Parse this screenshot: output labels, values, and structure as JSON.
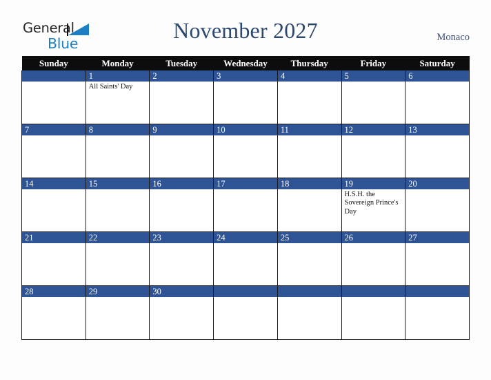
{
  "brand": {
    "word_one": "General",
    "word_two": "Blue",
    "accent_color": "#1c7fc4",
    "text_color": "#262626"
  },
  "header": {
    "title": "November 2027",
    "region": "Monaco",
    "title_color": "#2c4770"
  },
  "calendar": {
    "header_bg": "#0d0d0d",
    "daybar_bg": "#2f5495",
    "weekday_headers": [
      "Sunday",
      "Monday",
      "Tuesday",
      "Wednesday",
      "Thursday",
      "Friday",
      "Saturday"
    ],
    "weeks": [
      [
        {
          "day": "",
          "events": []
        },
        {
          "day": "1",
          "events": [
            "All Saints' Day"
          ]
        },
        {
          "day": "2",
          "events": []
        },
        {
          "day": "3",
          "events": []
        },
        {
          "day": "4",
          "events": []
        },
        {
          "day": "5",
          "events": []
        },
        {
          "day": "6",
          "events": []
        }
      ],
      [
        {
          "day": "7",
          "events": []
        },
        {
          "day": "8",
          "events": []
        },
        {
          "day": "9",
          "events": []
        },
        {
          "day": "10",
          "events": []
        },
        {
          "day": "11",
          "events": []
        },
        {
          "day": "12",
          "events": []
        },
        {
          "day": "13",
          "events": []
        }
      ],
      [
        {
          "day": "14",
          "events": []
        },
        {
          "day": "15",
          "events": []
        },
        {
          "day": "16",
          "events": []
        },
        {
          "day": "17",
          "events": []
        },
        {
          "day": "18",
          "events": []
        },
        {
          "day": "19",
          "events": [
            "H.S.H. the Sovereign Prince's Day"
          ]
        },
        {
          "day": "20",
          "events": []
        }
      ],
      [
        {
          "day": "21",
          "events": []
        },
        {
          "day": "22",
          "events": []
        },
        {
          "day": "23",
          "events": []
        },
        {
          "day": "24",
          "events": []
        },
        {
          "day": "25",
          "events": []
        },
        {
          "day": "26",
          "events": []
        },
        {
          "day": "27",
          "events": []
        }
      ],
      [
        {
          "day": "28",
          "events": []
        },
        {
          "day": "29",
          "events": []
        },
        {
          "day": "30",
          "events": []
        },
        {
          "day": "",
          "events": []
        },
        {
          "day": "",
          "events": []
        },
        {
          "day": "",
          "events": []
        },
        {
          "day": "",
          "events": []
        }
      ]
    ]
  }
}
